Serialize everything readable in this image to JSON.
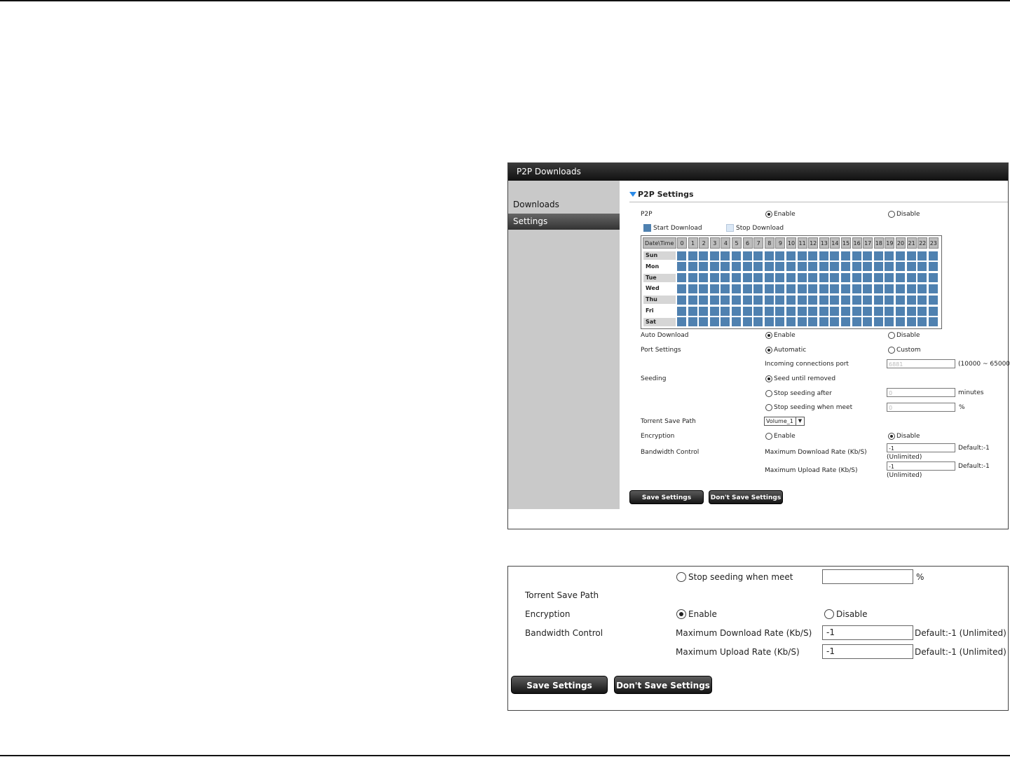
{
  "panel": {
    "title": "P2P Downloads",
    "sidebar": [
      {
        "label": "Downloads",
        "active": false
      },
      {
        "label": "Settings",
        "active": true
      }
    ],
    "section_title": "P2P Settings",
    "p2p": {
      "label": "P2P",
      "enable": "Enable",
      "disable": "Disable",
      "selected": "Enable"
    },
    "legend": {
      "start": "Start Download",
      "stop": "Stop Download",
      "start_color": "#4f81b0",
      "stop_color": "#dbe8f6"
    },
    "schedule": {
      "corner": "Date\\Time",
      "hours": [
        "0",
        "1",
        "2",
        "3",
        "4",
        "5",
        "6",
        "7",
        "8",
        "9",
        "10",
        "11",
        "12",
        "13",
        "14",
        "15",
        "16",
        "17",
        "18",
        "19",
        "20",
        "21",
        "22",
        "23"
      ],
      "days": [
        "Sun",
        "Mon",
        "Tue",
        "Wed",
        "Thu",
        "Fri",
        "Sat"
      ],
      "all_start_download": true
    },
    "auto_download": {
      "label": "Auto Download",
      "enable": "Enable",
      "disable": "Disable",
      "selected": "Enable"
    },
    "port_settings": {
      "label": "Port Settings",
      "automatic": "Automatic",
      "custom": "Custom",
      "selected": "Automatic",
      "incoming_label": "Incoming connections port",
      "port_value": "6881",
      "range": "(10000 ~ 65000)"
    },
    "seeding": {
      "label": "Seeding",
      "seed_until": "Seed until removed",
      "stop_after": "Stop seeding after",
      "stop_meet": "Stop seeding when meet",
      "after_value": "0",
      "after_unit": "minutes",
      "meet_value": "0",
      "meet_unit": "%",
      "selected": "Seed until removed"
    },
    "torrent_save_path": {
      "label": "Torrent Save Path",
      "value": "Volume_1"
    },
    "encryption": {
      "label": "Encryption",
      "enable": "Enable",
      "disable": "Disable",
      "selected": "Disable"
    },
    "bandwidth": {
      "label": "Bandwidth Control",
      "download_label": "Maximum Download Rate (Kb/S)",
      "download_value": "-1",
      "upload_label": "Maximum Upload Rate (Kb/S)",
      "upload_value": "-1",
      "default_text": "Default:-1",
      "unlimited_text": "(Unlimited)"
    },
    "buttons": {
      "save": "Save Settings",
      "dont_save": "Don't Save Settings"
    }
  },
  "zoom": {
    "stop_meet": "Stop seeding when meet",
    "meet_unit": "%",
    "torrent_save_path": "Torrent Save Path",
    "encryption": "Encryption",
    "enable": "Enable",
    "disable": "Disable",
    "encryption_selected": "Enable",
    "bandwidth": "Bandwidth Control",
    "download_label": "Maximum Download Rate (Kb/S)",
    "download_value": "-1",
    "upload_label": "Maximum Upload Rate (Kb/S)",
    "upload_value": "-1",
    "default_text": "Default:-1 (Unlimited)",
    "save": "Save Settings",
    "dont_save": "Don't Save Settings"
  }
}
